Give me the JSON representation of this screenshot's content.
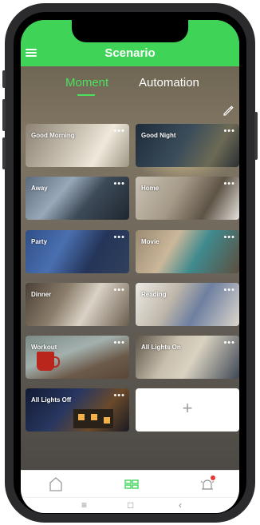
{
  "header": {
    "title": "Scenario",
    "menu_icon": "hamburger-menu-icon",
    "background_color": "#3fd458"
  },
  "tabs": [
    {
      "label": "Moment",
      "active": true,
      "color": "#4ae25f"
    },
    {
      "label": "Automation",
      "active": false,
      "color": "#ffffff"
    }
  ],
  "edit_icon": "pencil-edit-icon",
  "scenes": [
    {
      "label": "Good Morning",
      "more": "•••"
    },
    {
      "label": "Good Night",
      "more": "•••"
    },
    {
      "label": "Away",
      "more": "•••"
    },
    {
      "label": "Home",
      "more": "•••"
    },
    {
      "label": "Party",
      "more": "•••"
    },
    {
      "label": "Movie",
      "more": "•••"
    },
    {
      "label": "Dinner",
      "more": "•••"
    },
    {
      "label": "Reading",
      "more": "•••"
    },
    {
      "label": "Workout",
      "more": "•••"
    },
    {
      "label": "All Lights On",
      "more": "•••"
    },
    {
      "label": "All Lights Off",
      "more": "•••"
    }
  ],
  "add_scene": {
    "label": "+"
  },
  "bottom_nav": {
    "items": [
      {
        "icon": "home-icon",
        "active": false
      },
      {
        "icon": "scenes-grid-icon",
        "active": true
      },
      {
        "icon": "alarm-bell-icon",
        "active": false,
        "badge_color": "#e53935"
      }
    ],
    "active_color": "#3fd458"
  },
  "system_nav": {
    "menu": "≡",
    "home": "□",
    "back": "‹"
  }
}
